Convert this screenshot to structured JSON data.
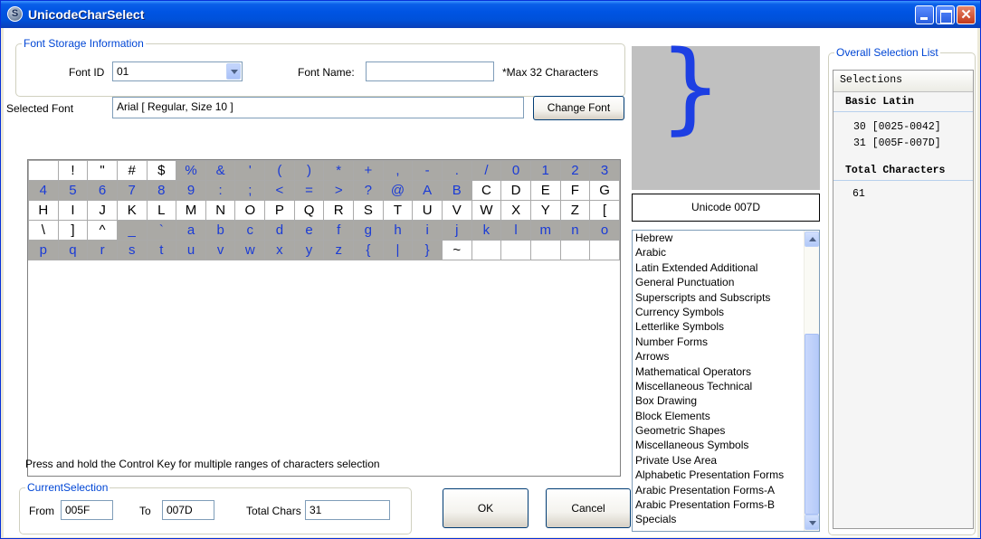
{
  "window": {
    "title": "UnicodeCharSelect",
    "icon_glyph": "S"
  },
  "font_storage": {
    "legend": "Font Storage Information",
    "font_id_label": "Font ID",
    "font_id_value": "01",
    "font_name_label": "Font Name:",
    "font_name_value": "",
    "max_note": "*Max 32 Characters",
    "selected_font_label": "Selected Font",
    "selected_font_value": "Arial   [ Regular, Size 10 ]",
    "change_font_button": "Change Font"
  },
  "grid": {
    "rows": [
      [
        " ",
        "!",
        "\"",
        "#",
        "$",
        "%",
        "&",
        "'",
        "(",
        ")",
        "*",
        "+",
        ",",
        "-",
        ".",
        "/",
        "0",
        "1",
        "2",
        "3"
      ],
      [
        "4",
        "5",
        "6",
        "7",
        "8",
        "9",
        ":",
        ";",
        "<",
        "=",
        ">",
        "?",
        "@",
        "A",
        "B",
        "C",
        "D",
        "E",
        "F",
        "G"
      ],
      [
        "H",
        "I",
        "J",
        "K",
        "L",
        "M",
        "N",
        "O",
        "P",
        "Q",
        "R",
        "S",
        "T",
        "U",
        "V",
        "W",
        "X",
        "Y",
        "Z",
        "["
      ],
      [
        "\\",
        "]",
        "^",
        "_",
        "`",
        "a",
        "b",
        "c",
        "d",
        "e",
        "f",
        "g",
        "h",
        "i",
        "j",
        "k",
        "l",
        "m",
        "n",
        "o"
      ],
      [
        "p",
        "q",
        "r",
        "s",
        "t",
        "u",
        "v",
        "w",
        "x",
        "y",
        "z",
        "{",
        "|",
        "}",
        "~",
        "",
        "",
        "",
        "",
        ""
      ]
    ],
    "selected_ranges": [
      [
        5,
        34
      ],
      [
        63,
        93
      ]
    ],
    "selected_bg": "#aaa9a5",
    "selected_color": "#1a3bd6"
  },
  "hint_text": "Press and hold the Control Key for multiple ranges of characters selection",
  "current_selection": {
    "legend": "CurrentSelection",
    "from_label": "From",
    "from_value": "005F",
    "to_label": "To",
    "to_value": "007D",
    "total_label": "Total Chars",
    "total_value": "31"
  },
  "buttons": {
    "ok": "OK",
    "cancel": "Cancel"
  },
  "preview": {
    "char": "}",
    "unicode_label": "Unicode 007D"
  },
  "blocks": [
    "Hebrew",
    "Arabic",
    "Latin Extended Additional",
    "General Punctuation",
    "Superscripts and Subscripts",
    "Currency Symbols",
    "Letterlike Symbols",
    "Number Forms",
    "Arrows",
    "Mathematical Operators",
    "Miscellaneous Technical",
    "Box Drawing",
    "Block Elements",
    "Geometric Shapes",
    "Miscellaneous Symbols",
    "Private Use Area",
    "Alphabetic Presentation Forms",
    "Arabic Presentation Forms-A",
    "Arabic Presentation Forms-B",
    "Specials"
  ],
  "overall": {
    "legend": "Overall Selection List",
    "header": "Selections",
    "section_title": "Basic Latin",
    "ranges": [
      "30 [0025-0042]",
      "31 [005F-007D]"
    ],
    "total_title": "Total Characters",
    "total_value": "61"
  }
}
